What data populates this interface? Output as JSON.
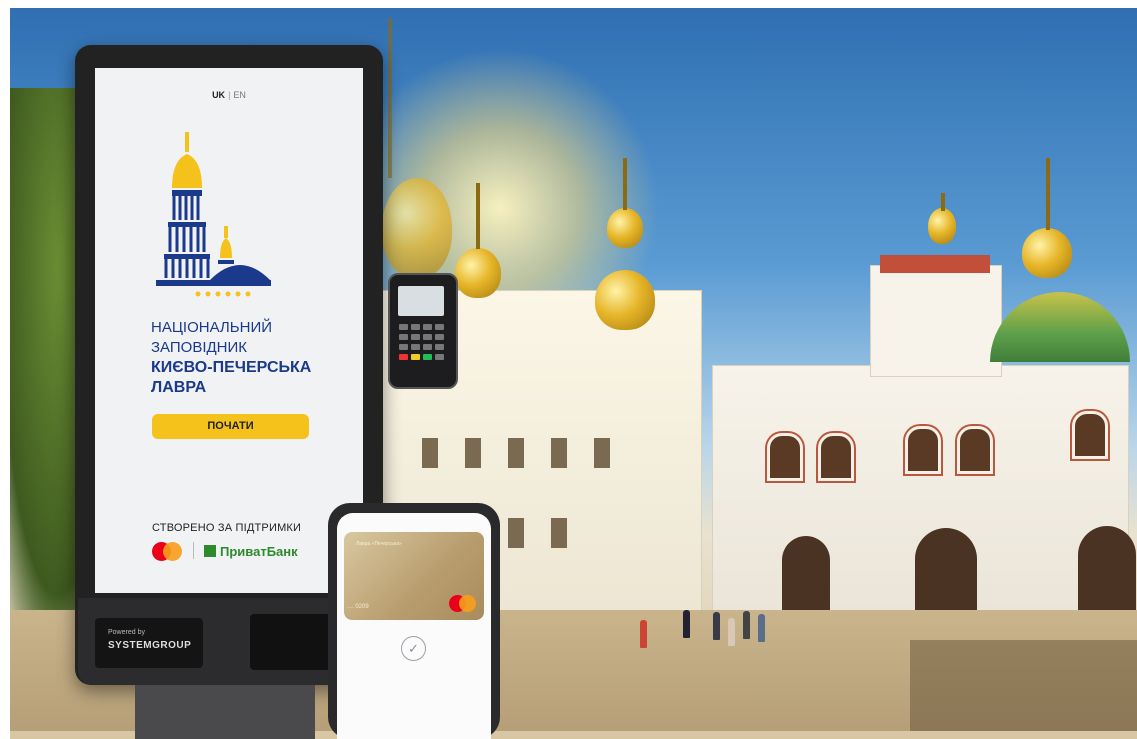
{
  "kiosk": {
    "lang_active": "UK",
    "lang_separator": "|",
    "lang_other": "EN",
    "title_line1": "НАЦІОНАЛЬНИЙ",
    "title_line2": "ЗАПОВІДНИК",
    "title_line3": "КИЄВО-ПЕЧЕРСЬКА",
    "title_line4": "ЛАВРА",
    "start_button": "ПОЧАТИ",
    "support_text": "СТВОРЕНО ЗА ПІДТРИМКИ",
    "bank_name": "ПриватБанк",
    "powered_by": "Powered by",
    "powered_brand": "SYSTEMGROUP"
  },
  "phone": {
    "card_label": "Лавра «Печерська»",
    "card_number": ".... 0209"
  },
  "colors": {
    "brand_blue": "#1b3a8c",
    "brand_yellow": "#f4c21a",
    "privat_green": "#2f8a2d",
    "mastercard_red": "#eb001b",
    "mastercard_orange": "#f79e1b"
  },
  "icons": [
    "mastercard-logo",
    "privatbank-logo",
    "lavra-logo",
    "check-icon"
  ]
}
